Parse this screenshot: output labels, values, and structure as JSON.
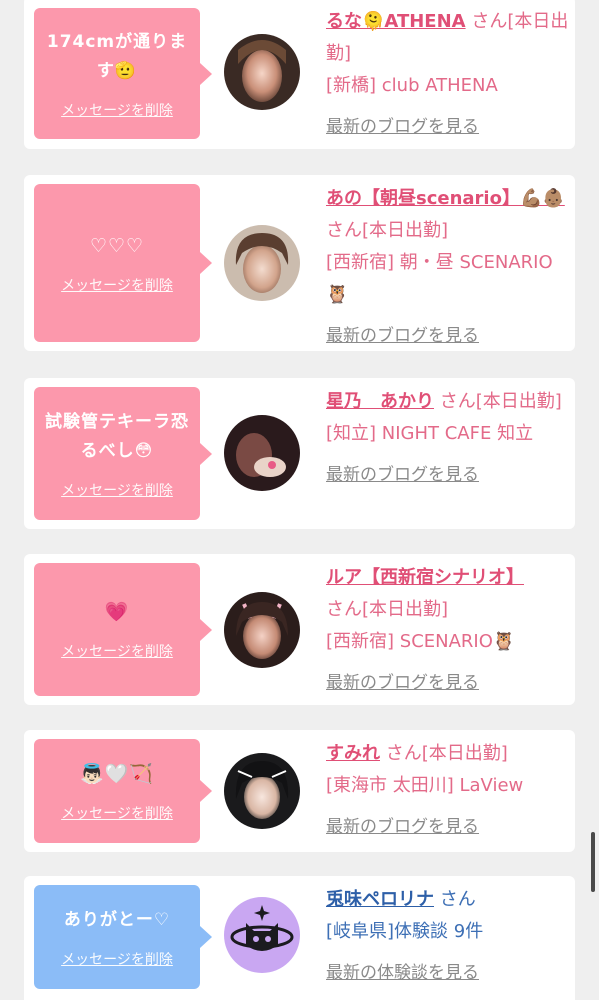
{
  "cards": [
    {
      "message": "174cmが通りま す🫡",
      "delete_label": "メッセージを削除",
      "name": "るな🫠ATHENA",
      "san_suffix": " さん[本日出勤]",
      "shop": "[新橋] club ATHENA",
      "blog_link": "最新のブログを見る",
      "theme": "pink"
    },
    {
      "message": "♡♡♡",
      "delete_label": "メッセージを削除",
      "name": "あの【朝昼scenario】💪🏽👶🏽",
      "san_suffix": " さん[本日出勤]",
      "shop": "[西新宿] 朝・昼 SCENARIO🦉",
      "blog_link": "最新のブログを見る",
      "theme": "pink"
    },
    {
      "message": "試験管テキーラ恐るべし😳",
      "delete_label": "メッセージを削除",
      "name": "星乃　あかり",
      "san_suffix": " さん[本日出勤]",
      "shop": "[知立] NIGHT CAFE 知立",
      "blog_link": "最新のブログを見る",
      "theme": "pink"
    },
    {
      "message": "💗",
      "delete_label": "メッセージを削除",
      "name": "ルア【西新宿シナリオ】",
      "san_suffix": " さん[本日出勤]",
      "shop": "[西新宿] SCENARIO🦉",
      "blog_link": "最新のブログを見る",
      "theme": "pink"
    },
    {
      "message": "👼🏻🤍🏹",
      "delete_label": "メッセージを削除",
      "name": "すみれ",
      "san_suffix": " さん[本日出勤]",
      "shop": "[東海市 太田川] LaView",
      "blog_link": "最新のブログを見る",
      "theme": "pink"
    },
    {
      "message": "ありがとー♡",
      "delete_label": "メッセージを削除",
      "name": "兎味ペロリナ",
      "san_suffix": " さん",
      "shop": "[岐阜県]体験談 9件",
      "blog_link": "最新の体験談を見る",
      "theme": "blue"
    }
  ],
  "colors": {
    "pink_bubble": "#fc98ac",
    "blue_bubble": "#8bbcf7",
    "pink_text": "#e36a89",
    "blue_text": "#3d6fb5",
    "background": "#efefef"
  }
}
